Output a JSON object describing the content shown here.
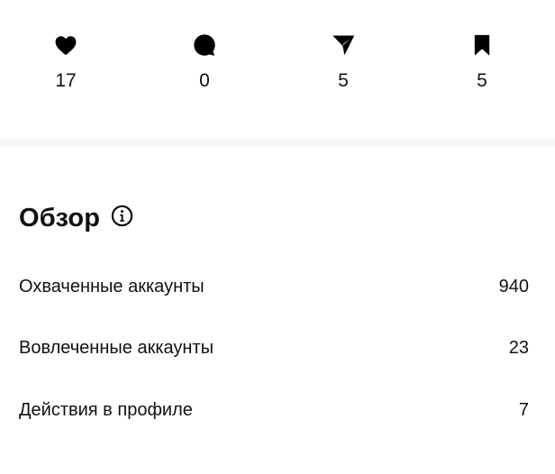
{
  "engagement": {
    "likes": {
      "icon": "heart-icon",
      "value": "17"
    },
    "comments": {
      "icon": "comment-bubble-icon",
      "value": "0"
    },
    "shares": {
      "icon": "paper-plane-icon",
      "value": "5"
    },
    "saves": {
      "icon": "bookmark-icon",
      "value": "5"
    }
  },
  "overview": {
    "title": "Обзор",
    "info_icon": "info-icon",
    "rows": [
      {
        "label": "Охваченные аккаунты",
        "value": "940"
      },
      {
        "label": "Вовлеченные аккаунты",
        "value": "23"
      },
      {
        "label": "Действия в профиле",
        "value": "7"
      }
    ]
  },
  "colors": {
    "text": "#111111",
    "divider": "#f7f7f7",
    "background": "#ffffff"
  }
}
